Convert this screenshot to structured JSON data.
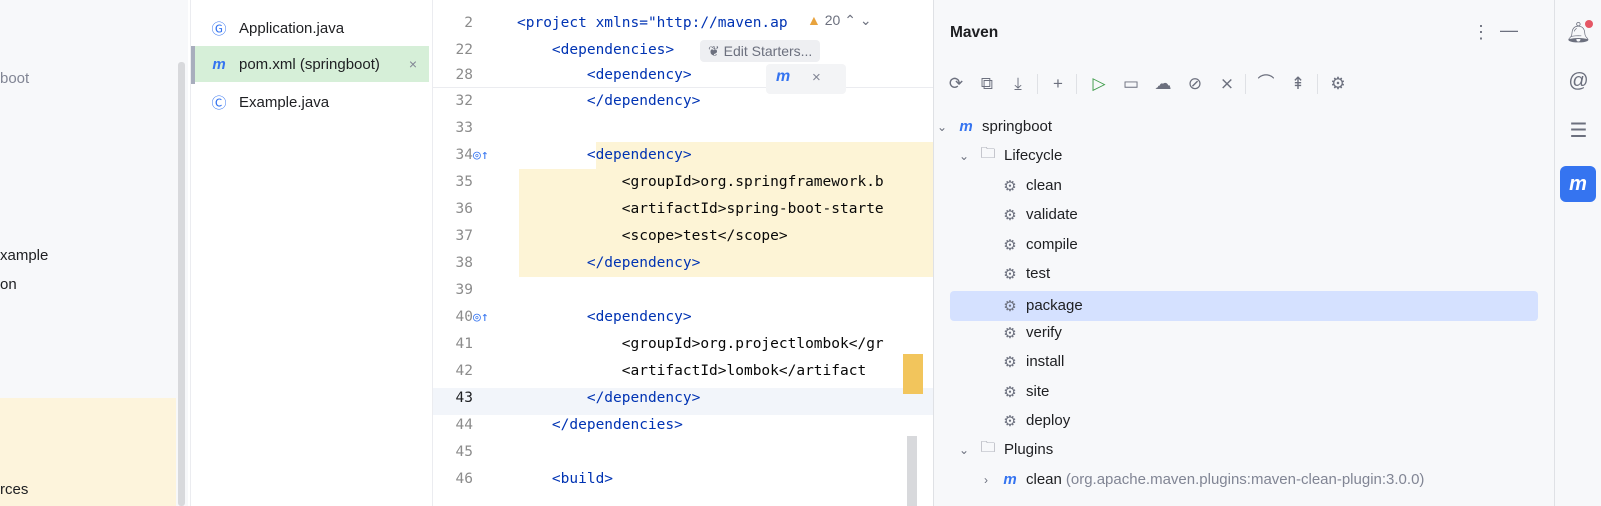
{
  "project_tree": {
    "items": [
      "boot",
      "xample",
      "on",
      "rces"
    ]
  },
  "files": [
    {
      "icon": "java-app-icon",
      "glyph": "Ⓖ",
      "name": "Application.java"
    },
    {
      "icon": "maven-icon",
      "glyph": "m",
      "name": "pom.xml (springboot)",
      "close": "×"
    },
    {
      "icon": "java-class-icon",
      "glyph": "Ⓒ",
      "name": "Example.java"
    }
  ],
  "editor": {
    "warning_count": "20",
    "inlay_hint": "Edit Starters...",
    "lines": [
      {
        "n": "2",
        "code": "<project xmlns=\"http://maven.ap"
      },
      {
        "n": "22",
        "code": "    <dependencies>"
      },
      {
        "n": "28",
        "code": "        <dependency>"
      },
      {
        "n": "32",
        "code": "        </dependency>"
      },
      {
        "n": "33",
        "code": ""
      },
      {
        "n": "34",
        "code": "        <dependency>"
      },
      {
        "n": "35",
        "code": "            <groupId>org.springframework.b"
      },
      {
        "n": "36",
        "code": "            <artifactId>spring-boot-starte"
      },
      {
        "n": "37",
        "code": "            <scope>test</scope>"
      },
      {
        "n": "38",
        "code": "        </dependency>"
      },
      {
        "n": "39",
        "code": ""
      },
      {
        "n": "40",
        "code": "        <dependency>"
      },
      {
        "n": "41",
        "code": "            <groupId>org.projectlombok</gr"
      },
      {
        "n": "42",
        "code": "            <artifactId>lombok</artifact"
      },
      {
        "n": "43",
        "code": "        </dependency>"
      },
      {
        "n": "44",
        "code": "    </dependencies>"
      },
      {
        "n": "45",
        "code": ""
      },
      {
        "n": "46",
        "code": "    <build>"
      }
    ]
  },
  "maven": {
    "title": "Maven",
    "root": "springboot",
    "lifecycle_label": "Lifecycle",
    "lifecycle": [
      "clean",
      "validate",
      "compile",
      "test",
      "package",
      "verify",
      "install",
      "site",
      "deploy"
    ],
    "selected": "package",
    "plugins_label": "Plugins",
    "plugin_clean": "clean",
    "plugin_clean_detail": "(org.apache.maven.plugins:maven-clean-plugin:3.0.0)",
    "toolbar": [
      "reload-icon",
      "generate-sources-icon",
      "download-icon",
      "add-icon",
      "run-icon",
      "execute-goal-icon",
      "offline-icon",
      "skip-tests-icon",
      "collapse-icon",
      "dependencies-icon",
      "show-icon",
      "settings-icon"
    ]
  },
  "strip": [
    "notifications-icon",
    "ai-assistant-icon",
    "database-icon",
    "maven-tool-icon"
  ]
}
